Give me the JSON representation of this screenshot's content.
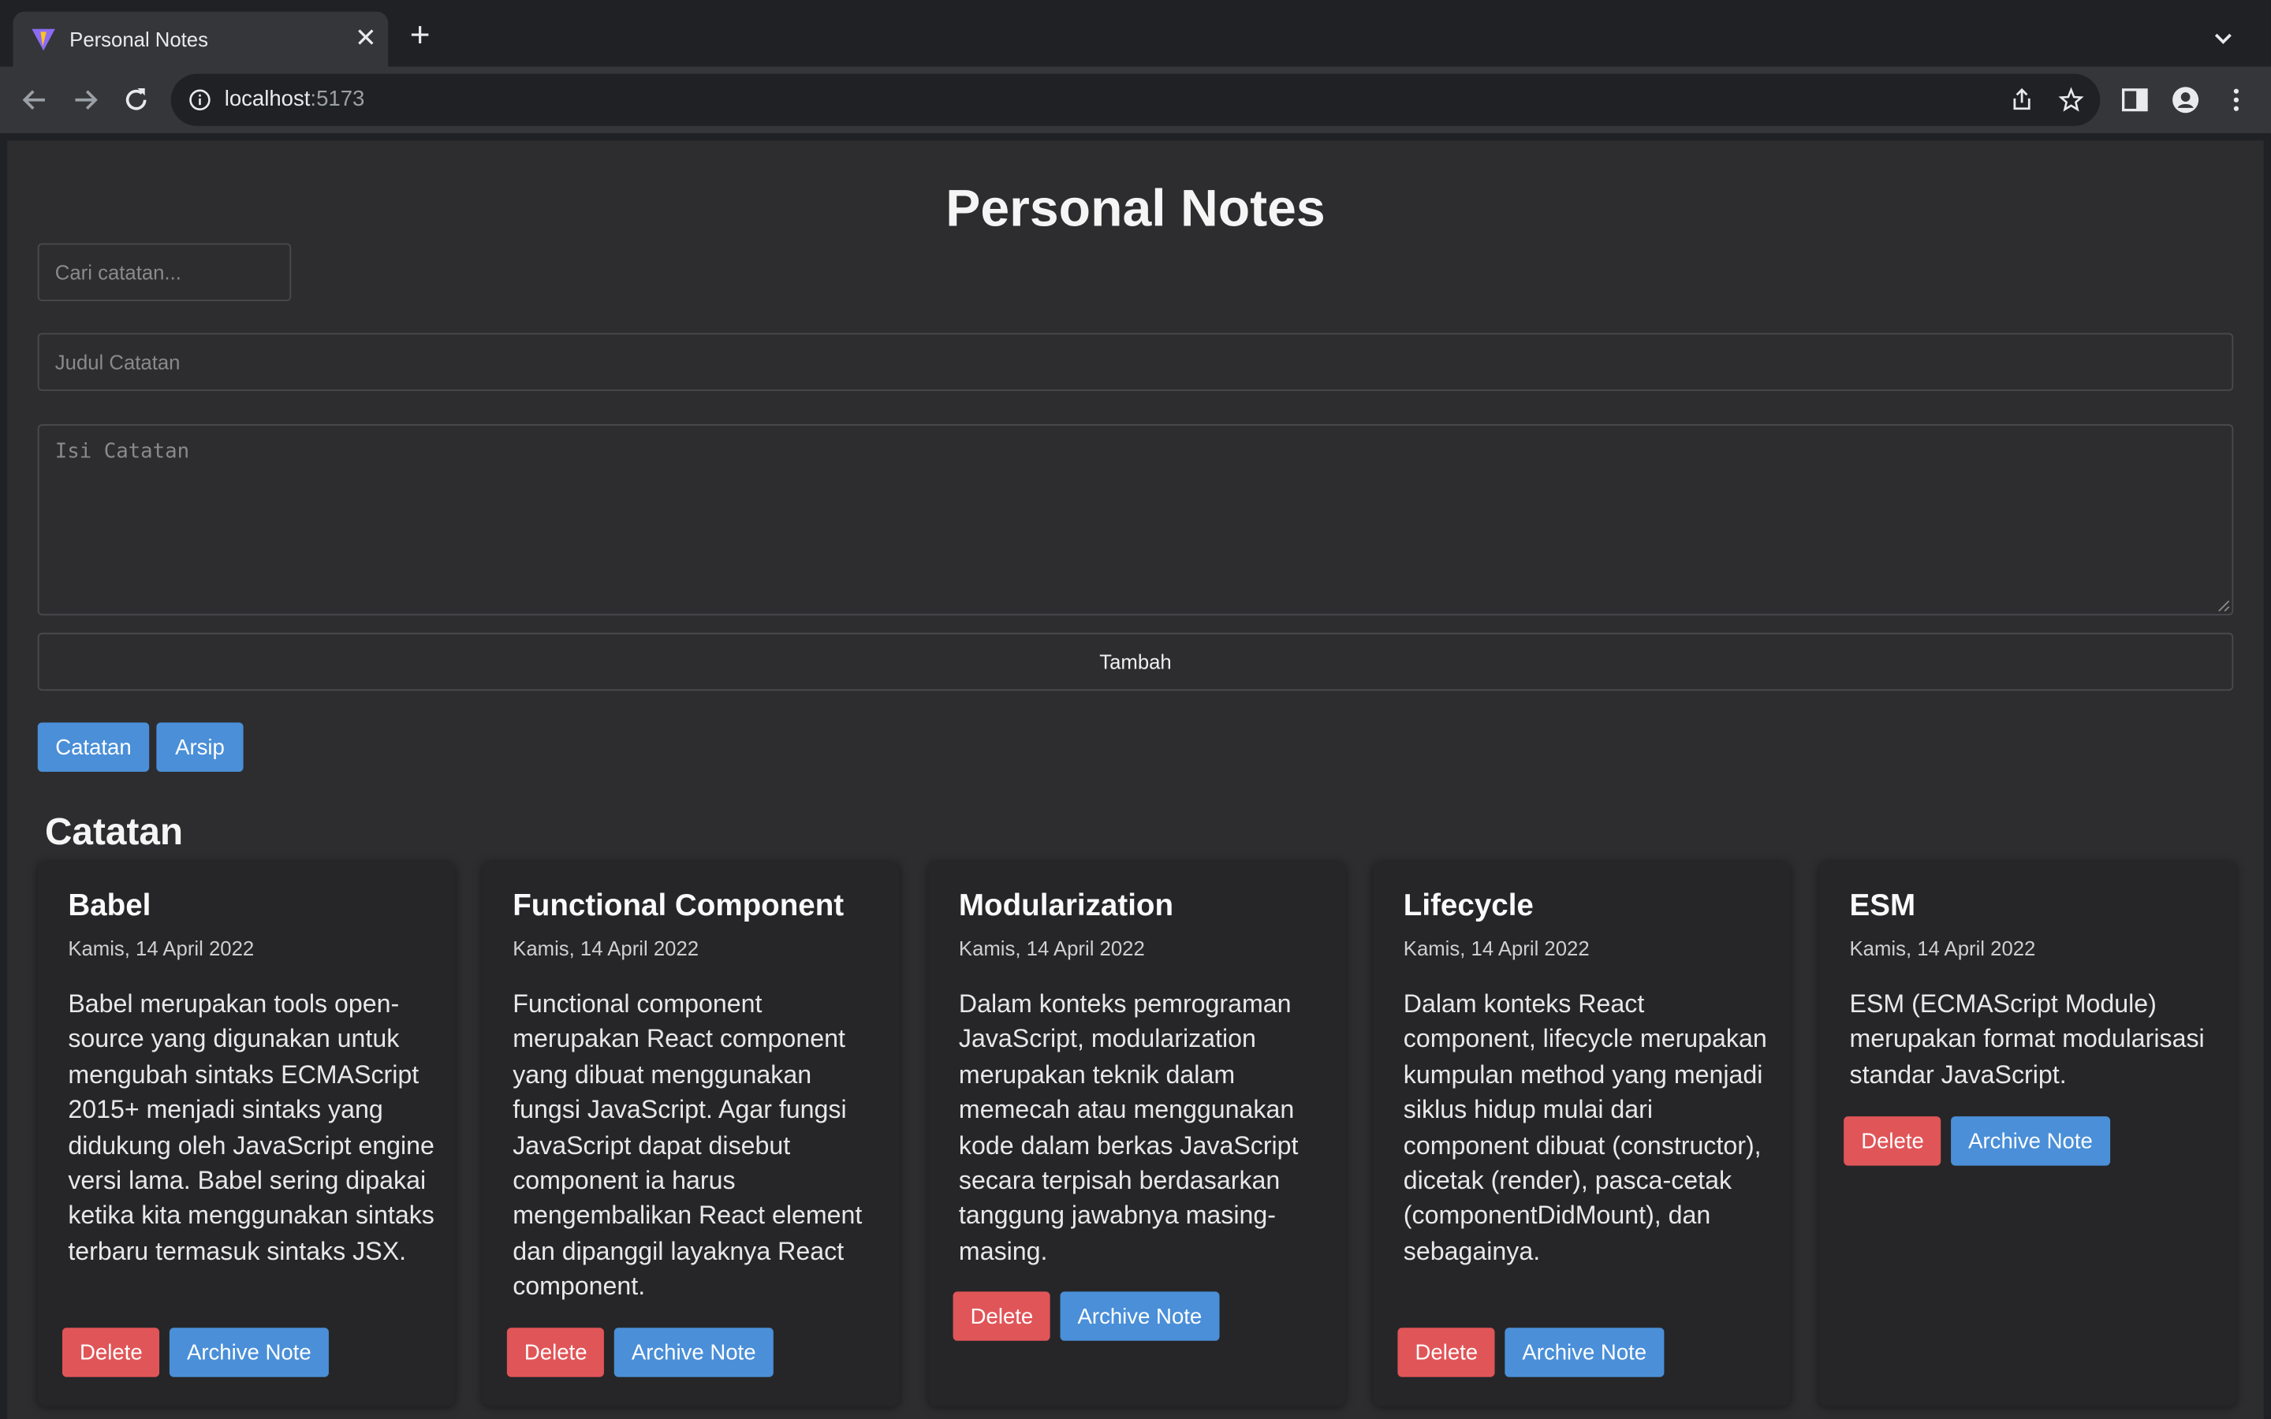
{
  "browser": {
    "tab_title": "Personal Notes",
    "url_host": "localhost",
    "url_port": ":5173"
  },
  "app": {
    "title": "Personal Notes",
    "search_placeholder": "Cari catatan...",
    "title_placeholder": "Judul Catatan",
    "body_placeholder": "Isi Catatan",
    "submit_label": "Tambah",
    "tabs": [
      {
        "label": "Catatan",
        "active": true
      },
      {
        "label": "Arsip",
        "active": false
      }
    ],
    "section_title": "Catatan"
  },
  "notes": [
    {
      "title": "Babel",
      "date": "Kamis, 14 April 2022",
      "body": "Babel merupakan tools open-source yang digunakan untuk mengubah sintaks ECMAScript 2015+ menjadi sintaks yang didukung oleh JavaScript engine versi lama. Babel sering dipakai ketika kita menggunakan sintaks terbaru termasuk sintaks JSX.",
      "delete_label": "Delete",
      "archive_label": "Archive Note"
    },
    {
      "title": "Functional Component",
      "date": "Kamis, 14 April 2022",
      "body": "Functional component merupakan React component yang dibuat menggunakan fungsi JavaScript. Agar fungsi JavaScript dapat disebut component ia harus mengembalikan React element dan dipanggil layaknya React component.",
      "delete_label": "Delete",
      "archive_label": "Archive Note"
    },
    {
      "title": "Modularization",
      "date": "Kamis, 14 April 2022",
      "body": "Dalam konteks pemrograman JavaScript, modularization merupakan teknik dalam memecah atau menggunakan kode dalam berkas JavaScript secara terpisah berdasarkan tanggung jawabnya masing-masing.",
      "delete_label": "Delete",
      "archive_label": "Archive Note"
    },
    {
      "title": "Lifecycle",
      "date": "Kamis, 14 April 2022",
      "body": "Dalam konteks React component, lifecycle merupakan kumpulan method yang menjadi siklus hidup mulai dari component dibuat (constructor), dicetak (render), pasca-cetak (componentDidMount), dan sebagainya.",
      "delete_label": "Delete",
      "archive_label": "Archive Note"
    },
    {
      "title": "ESM",
      "date": "Kamis, 14 April 2022",
      "body": "ESM (ECMAScript Module) merupakan format modularisasi standar JavaScript.",
      "delete_label": "Delete",
      "archive_label": "Archive Note"
    }
  ],
  "colors": {
    "accent_blue": "#4a8fd8",
    "danger_red": "#e05558",
    "page_bg": "#2d2d2f",
    "card_bg": "#262628"
  }
}
